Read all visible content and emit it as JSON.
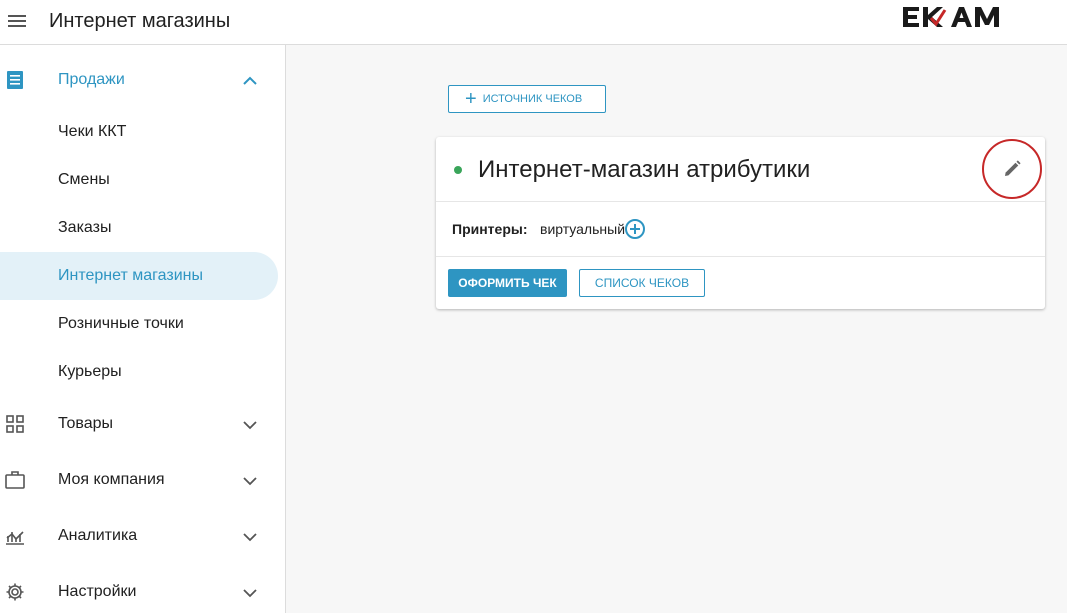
{
  "header": {
    "title": "Интернет магазины",
    "menu_icon": "hamburger-menu-icon",
    "logo_text": "EKAM"
  },
  "sidebar": {
    "groups": [
      {
        "label": "Продажи",
        "icon": "receipt-icon",
        "expanded": true,
        "items": [
          {
            "label": "Чеки ККТ",
            "active": false
          },
          {
            "label": "Смены",
            "active": false
          },
          {
            "label": "Заказы",
            "active": false
          },
          {
            "label": "Интернет магазины",
            "active": true
          },
          {
            "label": "Розничные точки",
            "active": false
          },
          {
            "label": "Курьеры",
            "active": false
          }
        ]
      },
      {
        "label": "Товары",
        "icon": "grid-icon",
        "expanded": false
      },
      {
        "label": "Моя компания",
        "icon": "briefcase-icon",
        "expanded": false
      },
      {
        "label": "Аналитика",
        "icon": "chart-icon",
        "expanded": false
      },
      {
        "label": "Настройки",
        "icon": "gear-icon",
        "expanded": false
      }
    ]
  },
  "main": {
    "source_button": "ИСТОЧНИК ЧЕКОВ",
    "store_card": {
      "status": "active",
      "title": "Интернет-магазин атрибутики",
      "printers_label": "Принтеры:",
      "printers_value": "виртуальный",
      "issue_button": "ОФОРМИТЬ ЧЕК",
      "list_button": "СПИСОК ЧЕКОВ"
    }
  },
  "colors": {
    "accent": "#2e95c2",
    "active_bg": "#e3f1f8",
    "status_green": "#3aa55a",
    "highlight_red": "#c62828"
  }
}
